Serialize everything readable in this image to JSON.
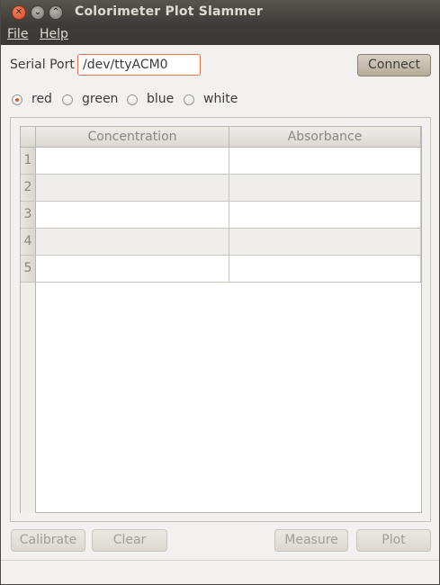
{
  "window": {
    "title": "Colorimeter Plot Slammer",
    "controls": {
      "close_glyph": "✕",
      "minimize_glyph": "⌄",
      "maximize_glyph": "⌃"
    }
  },
  "menubar": {
    "items": [
      {
        "label": "File"
      },
      {
        "label": "Help"
      }
    ]
  },
  "serial": {
    "label": "Serial Port",
    "value": "/dev/ttyACM0",
    "connect_label": "Connect"
  },
  "color_options": {
    "selected": "red",
    "options": [
      {
        "label": "red",
        "selected": true
      },
      {
        "label": "green",
        "selected": false
      },
      {
        "label": "blue",
        "selected": false
      },
      {
        "label": "white",
        "selected": false
      }
    ]
  },
  "table": {
    "columns": [
      "Concentration",
      "Absorbance"
    ],
    "rows": [
      {
        "num": "1",
        "concentration": "",
        "absorbance": ""
      },
      {
        "num": "2",
        "concentration": "",
        "absorbance": ""
      },
      {
        "num": "3",
        "concentration": "",
        "absorbance": ""
      },
      {
        "num": "4",
        "concentration": "",
        "absorbance": ""
      },
      {
        "num": "5",
        "concentration": "",
        "absorbance": ""
      }
    ]
  },
  "actions": {
    "calibrate": "Calibrate",
    "clear": "Clear",
    "measure": "Measure",
    "plot": "Plot"
  },
  "colors": {
    "titlebar": "#3d3c38",
    "accent": "#e05b2b",
    "background": "#f2f1f0"
  }
}
